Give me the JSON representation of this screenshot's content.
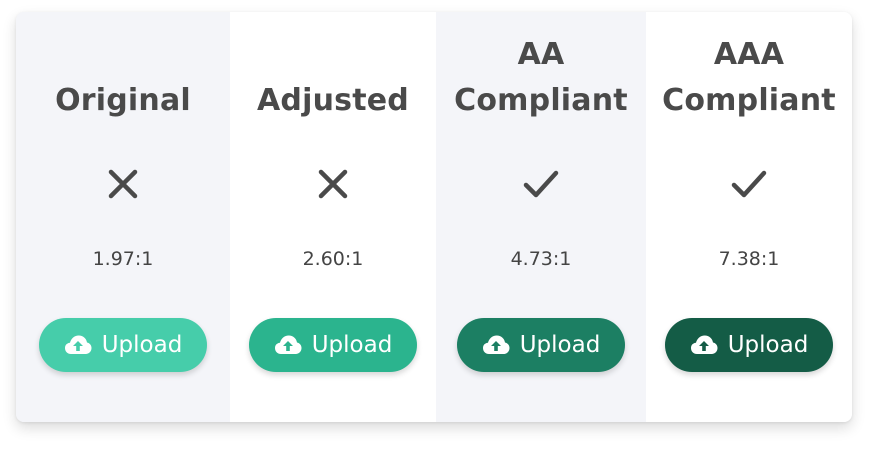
{
  "columns": [
    {
      "title_line1": "",
      "title_line2": "Original",
      "status_icon": "x-icon",
      "ratio": "1.97:1",
      "button_label": "Upload",
      "button_icon": "cloud-upload-icon",
      "button_color": "#46cdaa"
    },
    {
      "title_line1": "",
      "title_line2": "Adjusted",
      "status_icon": "x-icon",
      "ratio": "2.60:1",
      "button_label": "Upload",
      "button_icon": "cloud-upload-icon",
      "button_color": "#2bb48e"
    },
    {
      "title_line1": "AA",
      "title_line2": "Compliant",
      "status_icon": "check-icon",
      "ratio": "4.73:1",
      "button_label": "Upload",
      "button_icon": "cloud-upload-icon",
      "button_color": "#1c7f63"
    },
    {
      "title_line1": "AAA",
      "title_line2": "Compliant",
      "status_icon": "check-icon",
      "ratio": "7.38:1",
      "button_label": "Upload",
      "button_icon": "cloud-upload-icon",
      "button_color": "#145c46"
    }
  ],
  "colors": {
    "panel_shaded": "#f4f5f9",
    "panel_white": "#ffffff",
    "text": "#4a4a4a"
  }
}
